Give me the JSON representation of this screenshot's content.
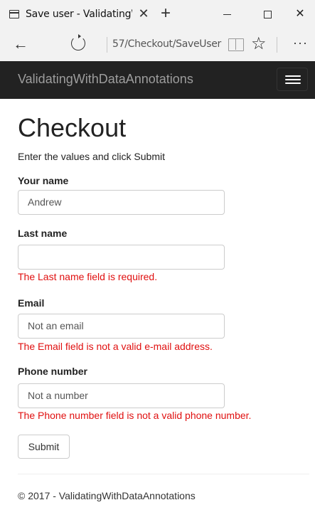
{
  "browser": {
    "tab_title": "Save user - ValidatingW",
    "tab_close": "✕",
    "new_tab": "+",
    "url": "57/Checkout/SaveUser",
    "win_close": "✕",
    "more": "···",
    "back": "←",
    "star": "☆"
  },
  "navbar": {
    "brand": "ValidatingWithDataAnnotations"
  },
  "page": {
    "title": "Checkout",
    "lead": "Enter the values and click Submit"
  },
  "form": {
    "your_name": {
      "label": "Your name",
      "value": "Andrew"
    },
    "last_name": {
      "label": "Last name",
      "value": "",
      "error": "The Last name field is required."
    },
    "email": {
      "label": "Email",
      "value": "Not an email",
      "error": "The Email field is not a valid e-mail address."
    },
    "phone": {
      "label": "Phone number",
      "value": "Not a number",
      "error": "The Phone number field is not a valid phone number."
    },
    "submit_label": "Submit"
  },
  "footer": {
    "text": "© 2017 - ValidatingWithDataAnnotations"
  },
  "colors": {
    "navbar_bg": "#222222",
    "brand_text": "#9d9d9d",
    "error_text": "#e01010",
    "chrome_bg": "#f2f2f2"
  }
}
